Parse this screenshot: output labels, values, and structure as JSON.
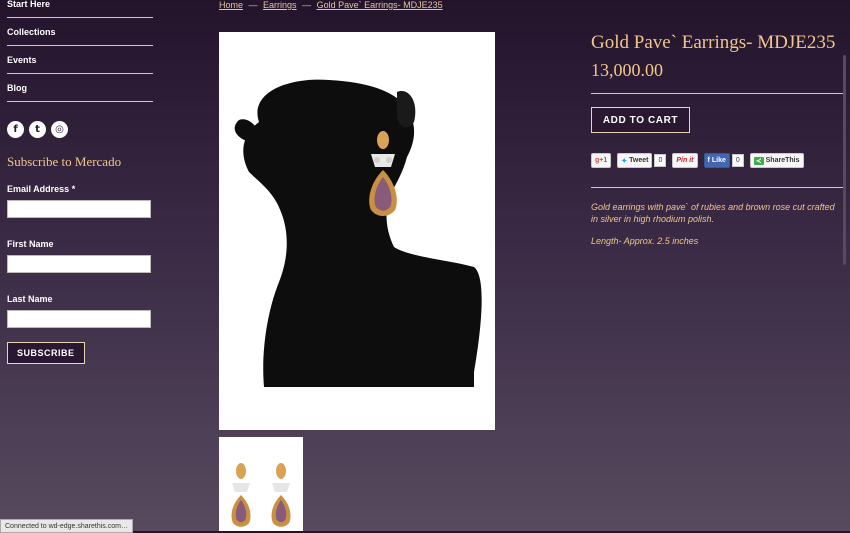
{
  "nav": {
    "items": [
      "Start Here",
      "Collections",
      "Events",
      "Blog"
    ]
  },
  "social": {
    "icons": [
      "facebook-icon",
      "twitter-icon",
      "instagram-icon"
    ],
    "glyphs": [
      "f",
      "t",
      "◎"
    ]
  },
  "subscribe": {
    "title": "Subscribe to Mercado",
    "email_label": "Email Address *",
    "first_name_label": "First Name",
    "last_name_label": "Last Name",
    "button": "SUBSCRIBE"
  },
  "breadcrumb": {
    "home": "Home",
    "category": "Earrings",
    "current": "Gold Pave` Earrings- MDJE235",
    "sep": "—"
  },
  "product": {
    "title": "Gold Pave` Earrings- MDJE235",
    "price": "13,000.00",
    "add_to_cart": "ADD TO CART",
    "description": [
      "Gold earrings with pave` of rubies and brown rose cut crafted in silver in high rhodium polish.",
      "Length- Approx. 2.5 inches"
    ]
  },
  "share": {
    "gplus": "g+1",
    "tweet": "Tweet",
    "tweet_count": "0",
    "pinit": "Pin it",
    "like": "Like",
    "like_count": "0",
    "sharethis": "ShareThis"
  },
  "status_bar": "Connected to wd-edge.sharethis.com…",
  "colors": {
    "accent": "#f0c78a",
    "background_top": "#23132b",
    "background_bottom": "#574a5e"
  }
}
